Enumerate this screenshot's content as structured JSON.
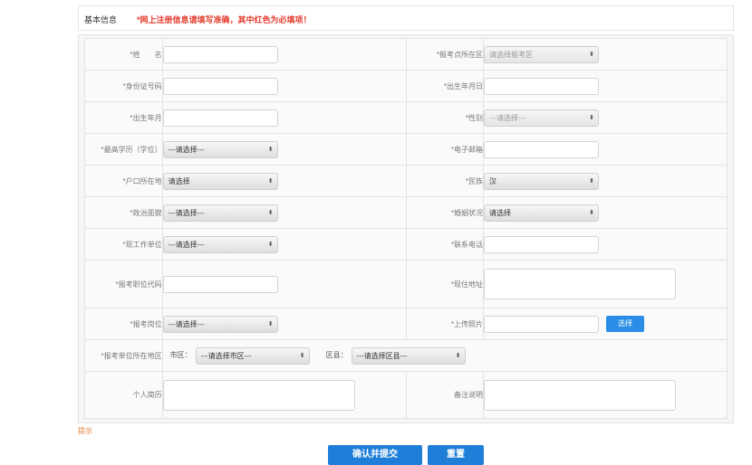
{
  "header": {
    "title": "基本信息",
    "warning": "*网上注册信息请填写准确，其中红色为必填项！"
  },
  "rows": [
    {
      "left_label": "*姓　　名",
      "left_type": "input",
      "left_value": "",
      "right_label": "*报考点所在区",
      "right_type": "select-grey",
      "right_value": "请选择报考区"
    },
    {
      "left_label": "*身份证号码",
      "left_type": "input",
      "left_value": "",
      "right_label": "*出生年月日",
      "right_type": "input",
      "right_value": ""
    },
    {
      "left_label": "*出生年月",
      "left_type": "input",
      "left_value": "",
      "right_label": "*性别",
      "right_type": "select-grey",
      "right_value": "---请选择---"
    },
    {
      "left_label": "*最高学历（学位）",
      "left_type": "select",
      "left_value": "---请选择---",
      "right_label": "*电子邮箱",
      "right_type": "input",
      "right_value": ""
    },
    {
      "left_label": "*户口所在地",
      "left_type": "select",
      "left_value": "请选择",
      "right_label": "*民族",
      "right_type": "select",
      "right_value": "汉"
    },
    {
      "left_label": "*政治面貌",
      "left_type": "select",
      "left_value": "---请选择---",
      "right_label": "*婚姻状况",
      "right_type": "select",
      "right_value": "请选择"
    },
    {
      "left_label": "*现工作单位",
      "left_type": "select",
      "left_value": "---请选择---",
      "right_label": "*联系电话",
      "right_type": "input",
      "right_value": ""
    },
    {
      "left_label": "*报考职位代码",
      "left_type": "input",
      "left_value": "",
      "right_label": "*现住地址",
      "right_type": "textarea",
      "right_value": ""
    },
    {
      "left_label": "*报考岗位",
      "left_type": "select",
      "left_value": "---请选择---",
      "right_label": "*上传照片",
      "right_type": "input-button",
      "right_value": "",
      "button_label": "选择"
    }
  ],
  "employment_row": {
    "label": "*报考单位所在地区",
    "city_label": "市区：",
    "city_value": "---请选择市区---",
    "district_label": "区县：",
    "district_value": "---请选择区县---"
  },
  "last_row": {
    "left_label": "个人简历",
    "right_label": "备注说明"
  },
  "note": "提示",
  "buttons": {
    "submit": "确认并提交",
    "reset": "重置"
  }
}
